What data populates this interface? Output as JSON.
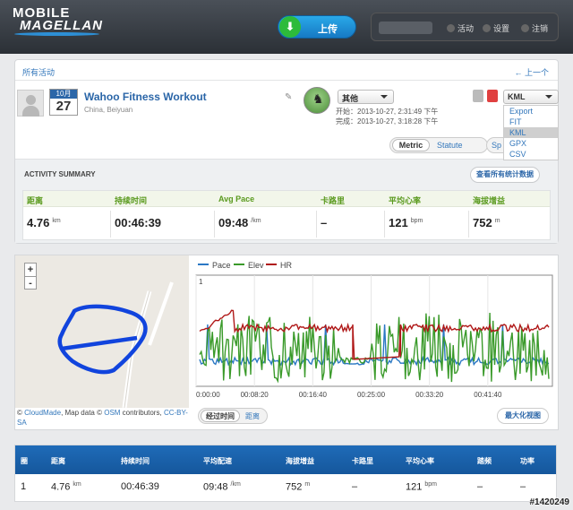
{
  "brand": {
    "line1": "MOBILE",
    "line2": "MAGELLAN"
  },
  "header": {
    "upload_label": "上传",
    "activity_label": "活动",
    "settings_label": "设置",
    "logout_label": "注销"
  },
  "nav": {
    "all_activities": "所有活动",
    "previous": "← 上一个"
  },
  "workout": {
    "month": "10月",
    "day": "27",
    "title": "Wahoo Fitness Workout",
    "location": "China, Beiyuan",
    "sport": "其他",
    "start_label": "开始：",
    "start_time": "2013-10-27, 2:31:49 下午",
    "end_label": "完成：",
    "end_time": "2013-10-27, 3:18:28 下午"
  },
  "export": {
    "selected": "KML",
    "options": [
      "Export",
      "FIT",
      "KML",
      "GPX",
      "CSV"
    ],
    "highlighted_index": 2
  },
  "units": {
    "metric": "Metric",
    "statute": "Statute",
    "speed_partial": "Sp"
  },
  "summary": {
    "title": "ACTIVITY SUMMARY",
    "view_all": "查看所有统计数据",
    "stats": [
      {
        "label": "距离",
        "value": "4.76",
        "unit": "km"
      },
      {
        "label": "持续时间",
        "value": "00:46:39",
        "unit": ""
      },
      {
        "label": "Avg Pace",
        "value": "09:48",
        "unit": "/km"
      },
      {
        "label": "卡路里",
        "value": "–",
        "unit": ""
      },
      {
        "label": "平均心率",
        "value": "121",
        "unit": "bpm"
      },
      {
        "label": "海拔增益",
        "value": "752",
        "unit": "m"
      }
    ]
  },
  "map": {
    "zoom_in": "+",
    "zoom_out": "-",
    "attribution_prefix": "©",
    "attr_cloudmade": "CloudMade",
    "attr_mid": ", Map data ©",
    "attr_osm": "OSM",
    "attr_contrib": " contributors,",
    "attr_license": "CC-BY-SA"
  },
  "chart_controls": {
    "elapsed": "经过时间",
    "distance": "距离",
    "maximize": "最大化视图"
  },
  "chart_data": {
    "type": "line",
    "series": [
      {
        "name": "Pace",
        "color": "#2b78c4"
      },
      {
        "name": "Elev",
        "color": "#3a9a2a"
      },
      {
        "name": "HR",
        "color": "#b01818"
      }
    ],
    "x_ticks": [
      "0:00:00",
      "00:08:20",
      "00:16:40",
      "00:25:00",
      "00:33:20",
      "00:41:40"
    ],
    "y_tick": "1"
  },
  "table": {
    "headers": [
      "圈",
      "距离",
      "持续时间",
      "平均配速",
      "海拔增益",
      "卡路里",
      "平均心率",
      "踏频",
      "功率"
    ],
    "row": [
      {
        "value": "1",
        "unit": ""
      },
      {
        "value": "4.76",
        "unit": "km"
      },
      {
        "value": "00:46:39",
        "unit": ""
      },
      {
        "value": "09:48",
        "unit": "/km"
      },
      {
        "value": "752",
        "unit": "m"
      },
      {
        "value": "–",
        "unit": ""
      },
      {
        "value": "121",
        "unit": "bpm"
      },
      {
        "value": "–",
        "unit": ""
      },
      {
        "value": "–",
        "unit": ""
      }
    ]
  },
  "watermark": "#1420249"
}
